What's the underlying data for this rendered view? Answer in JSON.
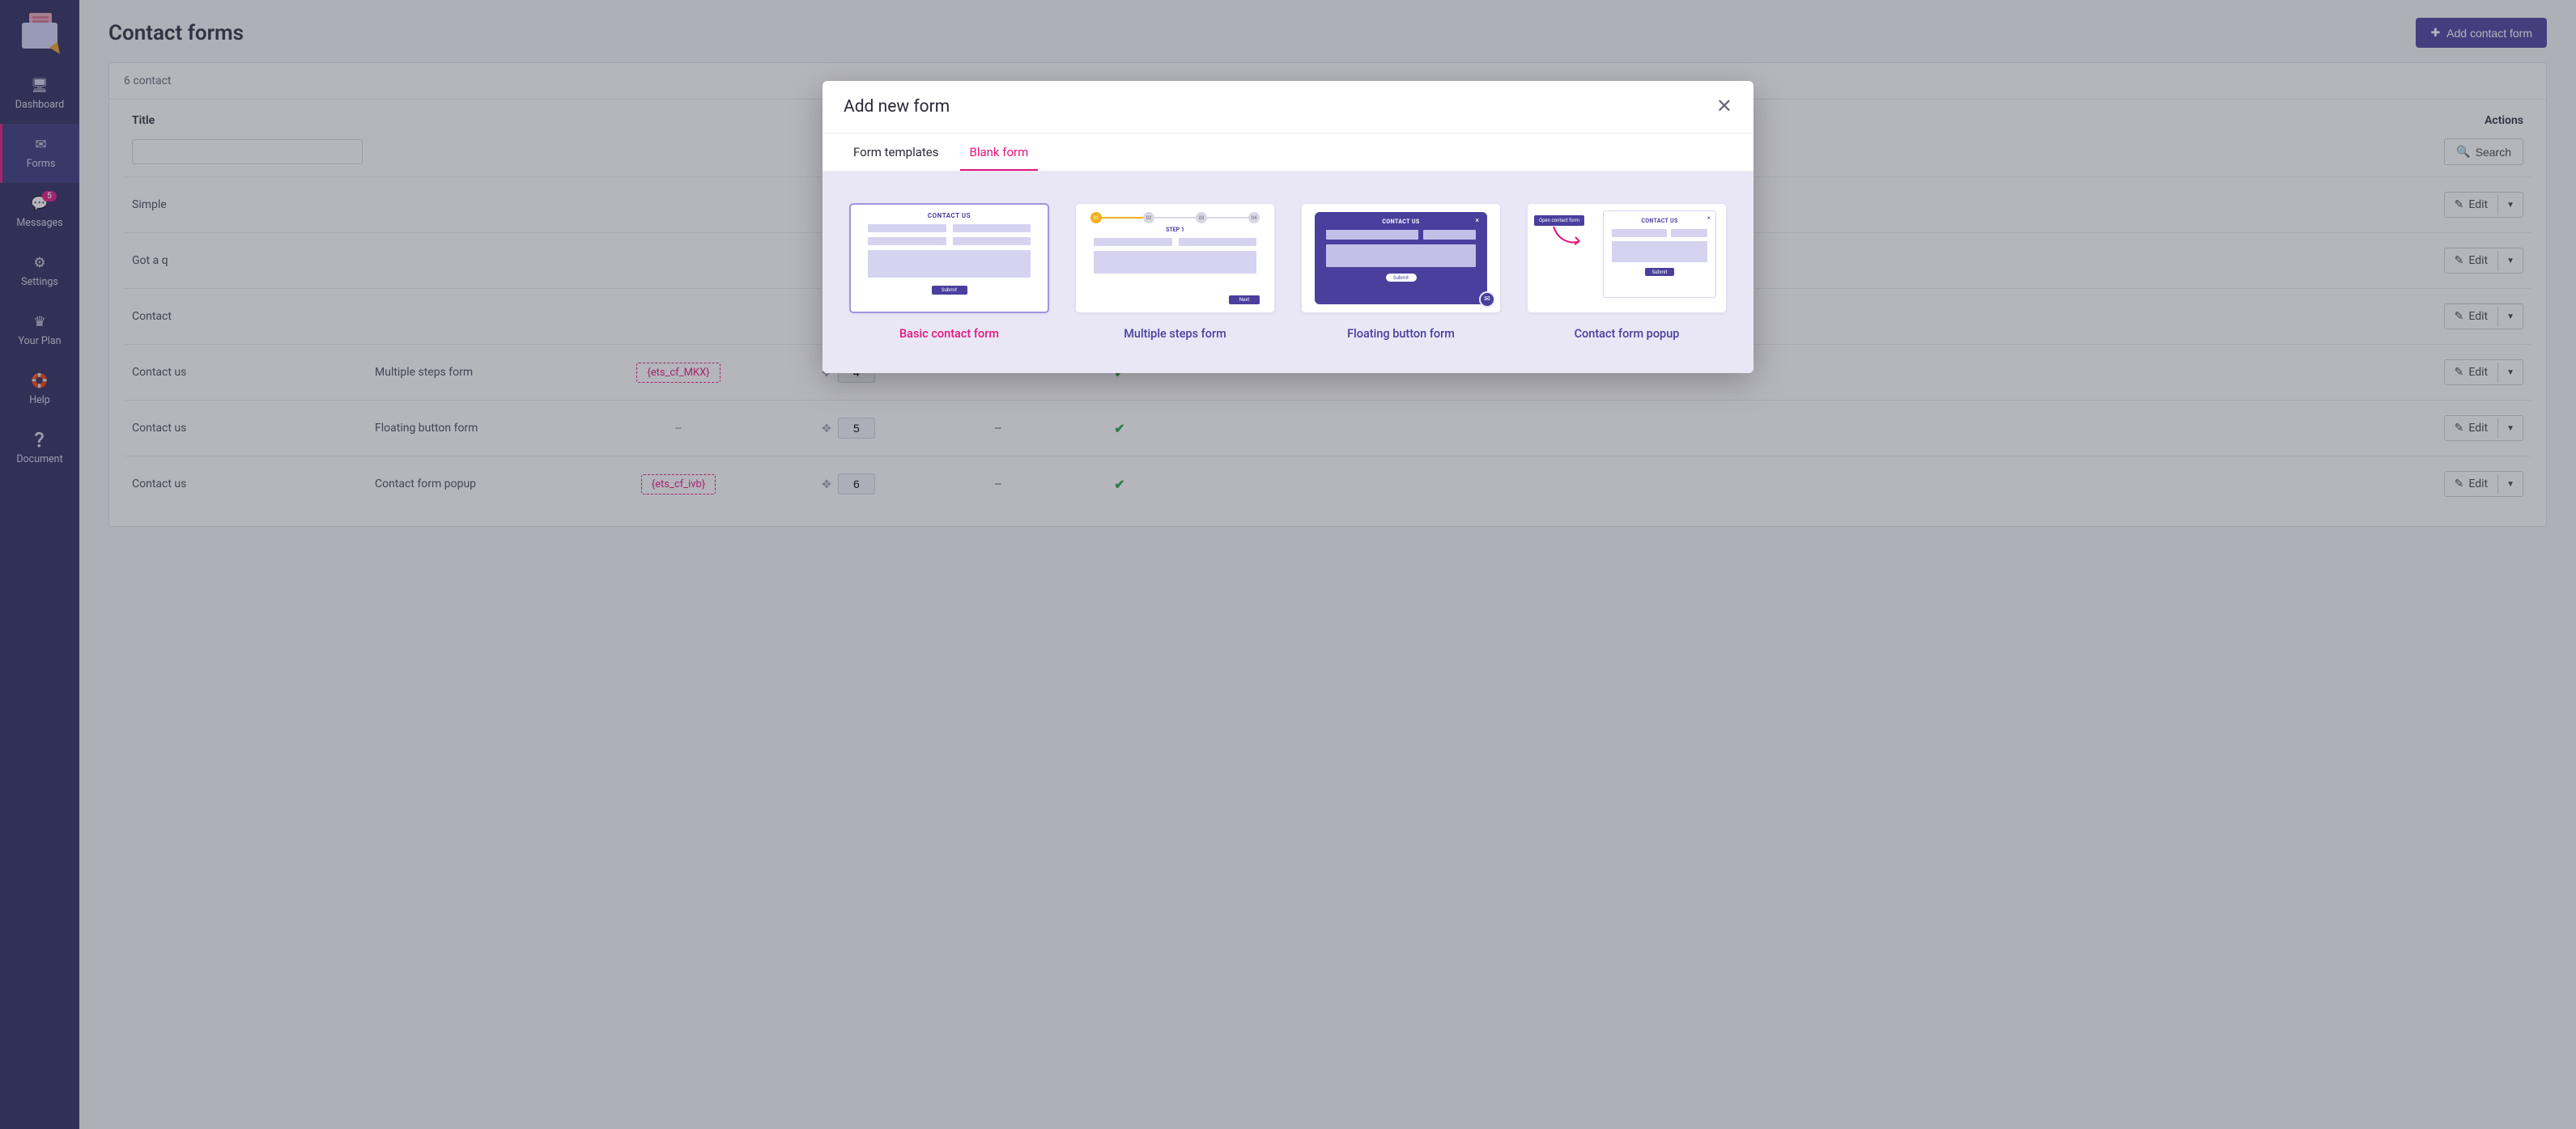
{
  "sidebar": {
    "items": [
      {
        "label": "Dashboard"
      },
      {
        "label": "Forms"
      },
      {
        "label": "Messages",
        "badge": "5"
      },
      {
        "label": "Settings"
      },
      {
        "label": "Your Plan"
      },
      {
        "label": "Help"
      },
      {
        "label": "Document"
      }
    ]
  },
  "header": {
    "title": "Contact forms",
    "add_button": "Add contact form"
  },
  "panel": {
    "count_label": "6 contact"
  },
  "table": {
    "headers": {
      "title": "Title",
      "actions": "Actions"
    },
    "search_button": "Search",
    "edit_label": "Edit",
    "rows": [
      {
        "title": "Simple",
        "type": "",
        "shortcode": "",
        "position": "",
        "language": "",
        "active": true
      },
      {
        "title": "Got a q",
        "type": "",
        "shortcode": "",
        "position": "",
        "language": "",
        "active": true
      },
      {
        "title": "Contact",
        "type": "",
        "shortcode": "",
        "position": "",
        "language": "",
        "active": true
      },
      {
        "title": "Contact us",
        "type": "Multiple steps form",
        "shortcode": "{ets_cf_MKX}",
        "position": "4",
        "language": "--",
        "active": true
      },
      {
        "title": "Contact us",
        "type": "Floating button form",
        "shortcode": "--",
        "position": "5",
        "language": "--",
        "active": true
      },
      {
        "title": "Contact us",
        "type": "Contact form popup",
        "shortcode": "{ets_cf_ivb}",
        "position": "6",
        "language": "--",
        "active": true
      }
    ]
  },
  "modal": {
    "title": "Add new form",
    "tabs": [
      {
        "label": "Form templates",
        "active": false
      },
      {
        "label": "Blank form",
        "active": true
      }
    ],
    "templates": [
      {
        "label": "Basic contact form",
        "selected": true,
        "preview_title": "CONTACT US",
        "preview_button": "Submit"
      },
      {
        "label": "Multiple steps form",
        "selected": false,
        "step_label": "STEP 1",
        "preview_button": "Next",
        "steps": [
          "01",
          "02",
          "03",
          "04"
        ]
      },
      {
        "label": "Floating button form",
        "selected": false,
        "preview_title": "CONTACT US",
        "preview_button": "Submit"
      },
      {
        "label": "Contact form popup",
        "selected": false,
        "tag": "Open contact form",
        "preview_title": "CONTACT US",
        "preview_button": "Submit"
      }
    ]
  }
}
